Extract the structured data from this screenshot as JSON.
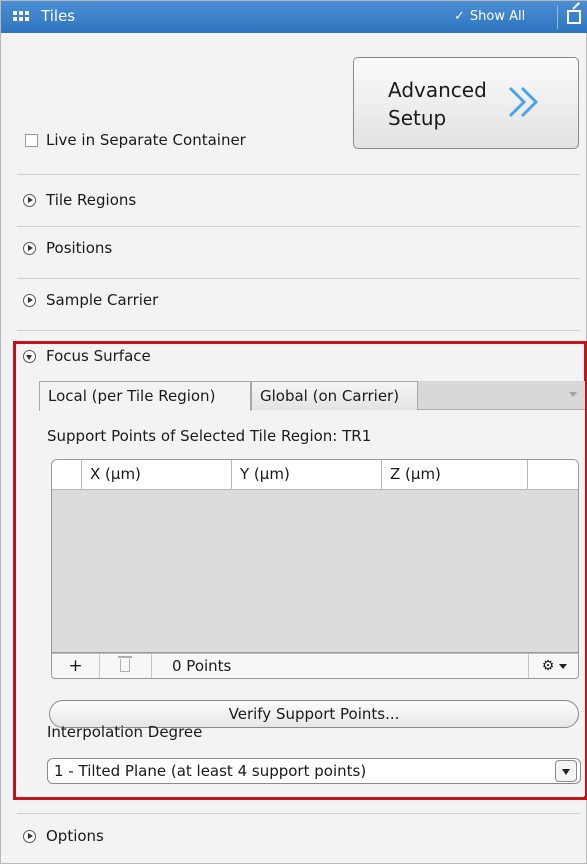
{
  "titlebar": {
    "title": "Tiles",
    "show_all_label": "Show All",
    "icons": [
      "tiles-icon",
      "check-icon",
      "undock-icon"
    ]
  },
  "advanced_setup": {
    "line1": "Advanced",
    "line2": "Setup",
    "icon": "double-chevron-right-icon",
    "chevron_color": "#4aa3ef"
  },
  "live_container": {
    "label": "Live in Separate Container",
    "checked": false
  },
  "sections": {
    "tile_regions": "Tile Regions",
    "positions": "Positions",
    "sample_carrier": "Sample Carrier",
    "focus_surface": "Focus Surface",
    "options": "Options"
  },
  "focus_surface": {
    "tabs": [
      {
        "label": "Local (per Tile Region)",
        "active": true
      },
      {
        "label": "Global (on Carrier)",
        "active": false
      }
    ],
    "support_points_label": "Support Points of Selected Tile Region:",
    "tile_region_name": "TR1",
    "table": {
      "columns": [
        "X (µm)",
        "Y (µm)",
        "Z (µm)"
      ],
      "rows": []
    },
    "footer": {
      "add_label": "+",
      "points_count": "0 Points"
    },
    "verify_button": "Verify Support Points...",
    "interpolation_label": "Interpolation Degree",
    "interpolation_value": "1 - Tilted Plane (at least 4 support points)"
  },
  "colors": {
    "titlebar": "#3a80c8",
    "highlight_border": "#c0151d"
  }
}
